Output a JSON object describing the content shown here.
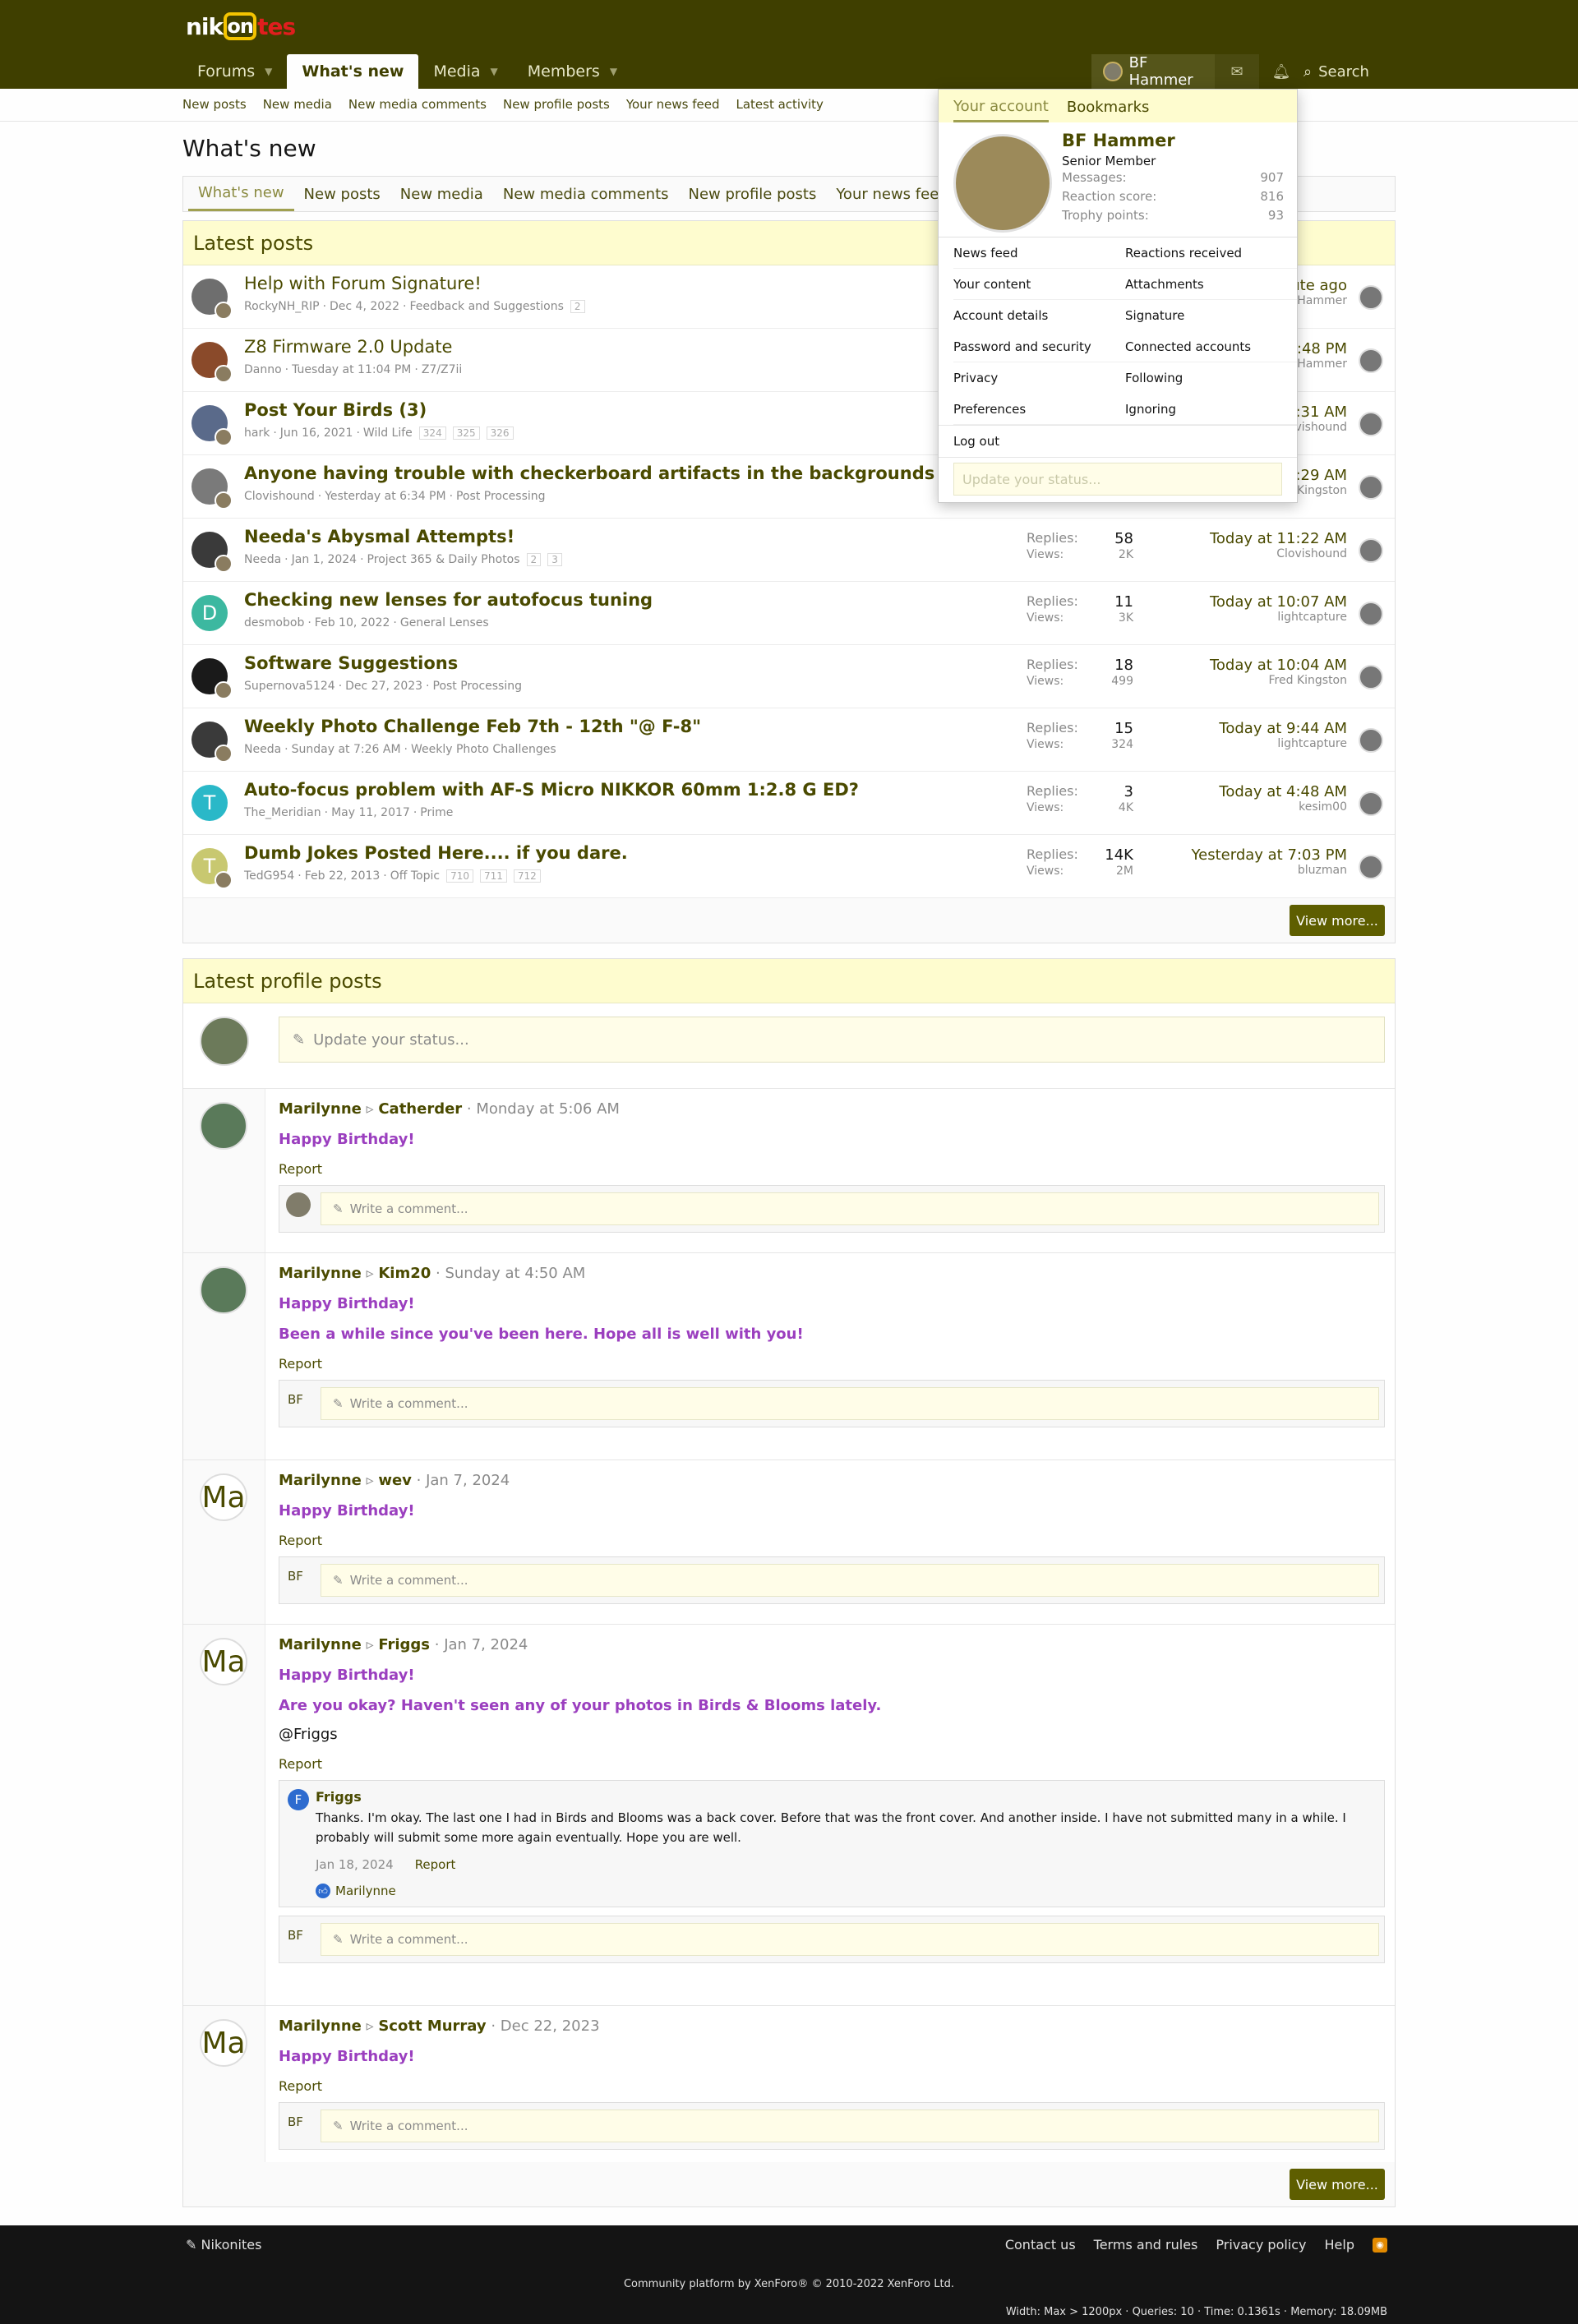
{
  "header": {
    "logo_a": "nik",
    "logo_b": "on",
    "logo_c": "tes",
    "nav": [
      {
        "label": "Forums",
        "dropdown": true
      },
      {
        "label": "What's new",
        "dropdown": false,
        "selected": true
      },
      {
        "label": "Media",
        "dropdown": true
      },
      {
        "label": "Members",
        "dropdown": true
      }
    ],
    "account_name": "BF Hammer",
    "search_label": "Search",
    "icons": [
      "envelope-icon",
      "bell-icon",
      "search-icon"
    ]
  },
  "subnav": [
    "New posts",
    "New media",
    "New media comments",
    "New profile posts",
    "Your news feed",
    "Latest activity"
  ],
  "page_title": "What's new",
  "tabs": [
    "What's new",
    "New posts",
    "New media",
    "New media comments",
    "New profile posts",
    "Your news feed",
    "Latest activity"
  ],
  "latest_posts": {
    "title": "Latest posts",
    "view_more": "View more...",
    "rows": [
      {
        "title": "Help with Forum Signature!",
        "bold": false,
        "author": "RockyNH_RIP",
        "date": "Dec 4, 2022",
        "forum": "Feedback and Suggestions",
        "pages": [
          "2"
        ],
        "replies": "",
        "views": "",
        "last_date": "A minute ago",
        "last_user": "BF Hammer",
        "avatar_color": "#6e6e6e",
        "avatar_text": ""
      },
      {
        "title": "Z8 Firmware 2.0 Update",
        "bold": false,
        "author": "Danno",
        "date": "Tuesday at 11:04 PM",
        "forum": "Z7/Z7ii",
        "pages": [],
        "replies": "",
        "views": "",
        "last_date": "Today at 12:48 PM",
        "last_user": "BF Hammer",
        "avatar_color": "#8a4a2a",
        "avatar_text": ""
      },
      {
        "title": "Post Your Birds (3)",
        "bold": true,
        "author": "hark",
        "date": "Jun 16, 2021",
        "forum": "Wild Life",
        "pages": [
          "324",
          "325",
          "326"
        ],
        "replies": "",
        "views": "",
        "last_date": "Today at 11:31 AM",
        "last_user": "Clovishound",
        "avatar_color": "#5a6a8a",
        "avatar_text": ""
      },
      {
        "title": "Anyone having trouble with checkerboard artifacts in the backgrounds with Topaz AI?",
        "bold": true,
        "author": "Clovishound",
        "date": "Yesterday at 6:34 PM",
        "forum": "Post Processing",
        "pages": [],
        "replies": "",
        "views": "",
        "last_date": "Today at 11:29 AM",
        "last_user": "Fred Kingston",
        "avatar_color": "#7a7a7a",
        "avatar_text": ""
      },
      {
        "title": "Needa's Abysmal Attempts!",
        "bold": true,
        "author": "Needa",
        "date": "Jan 1, 2024",
        "forum": "Project 365 & Daily Photos",
        "pages": [
          "2",
          "3"
        ],
        "replies": "58",
        "views": "2K",
        "last_date": "Today at 11:22 AM",
        "last_user": "Clovishound",
        "avatar_color": "#3a3a3a",
        "avatar_text": ""
      },
      {
        "title": "Checking new lenses for autofocus tuning",
        "bold": true,
        "author": "desmobob",
        "date": "Feb 10, 2022",
        "forum": "General Lenses",
        "pages": [],
        "replies": "11",
        "views": "3K",
        "last_date": "Today at 10:07 AM",
        "last_user": "lightcapture",
        "avatar_color": "#3cb8a0",
        "avatar_text": "D"
      },
      {
        "title": "Software Suggestions",
        "bold": true,
        "author": "Supernova5124",
        "date": "Dec 27, 2023",
        "forum": "Post Processing",
        "pages": [],
        "replies": "18",
        "views": "499",
        "last_date": "Today at 10:04 AM",
        "last_user": "Fred Kingston",
        "avatar_color": "#1a1a1a",
        "avatar_text": ""
      },
      {
        "title": "Weekly Photo Challenge Feb 7th - 12th \"@ F-8\"",
        "bold": true,
        "author": "Needa",
        "date": "Sunday at 7:26 AM",
        "forum": "Weekly Photo Challenges",
        "pages": [],
        "replies": "15",
        "views": "324",
        "last_date": "Today at 9:44 AM",
        "last_user": "lightcapture",
        "avatar_color": "#3a3a3a",
        "avatar_text": ""
      },
      {
        "title": "Auto-focus problem with AF-S Micro NIKKOR 60mm 1:2.8 G ED?",
        "bold": true,
        "author": "The_Meridian",
        "date": "May 11, 2017",
        "forum": "Prime",
        "pages": [],
        "replies": "3",
        "views": "4K",
        "last_date": "Today at 4:48 AM",
        "last_user": "kesim00",
        "avatar_color": "#2ab8c8",
        "avatar_text": "T"
      },
      {
        "title": "Dumb Jokes Posted Here.... if you dare.",
        "bold": true,
        "author": "TedG954",
        "date": "Feb 22, 2013",
        "forum": "Off Topic",
        "pages": [
          "710",
          "711",
          "712"
        ],
        "replies": "14K",
        "views": "2M",
        "last_date": "Yesterday at 7:03 PM",
        "last_user": "bluzman",
        "avatar_color": "#c8c870",
        "avatar_text": "T"
      }
    ],
    "labels": {
      "replies": "Replies:",
      "views": "Views:"
    }
  },
  "profile_posts": {
    "title": "Latest profile posts",
    "status_placeholder": "Update your status...",
    "comment_placeholder": "Write a comment...",
    "report": "Report",
    "view_more": "View more...",
    "bf": "BF",
    "posts": [
      {
        "author": "Marilynne",
        "target": "Catherder",
        "date": "Monday at 5:06 AM",
        "messages": [
          "Happy Birthday!"
        ],
        "plain": [],
        "photo": true,
        "reply": null
      },
      {
        "author": "Marilynne",
        "target": "Kim20",
        "date": "Sunday at 4:50 AM",
        "messages": [
          "Happy Birthday!",
          "Been a while since you've been here. Hope all is well with you!"
        ],
        "plain": [],
        "photo": true,
        "reply": null
      },
      {
        "author": "Marilynne",
        "target": "wev",
        "date": "Jan 7, 2024",
        "messages": [
          "Happy Birthday!"
        ],
        "plain": [],
        "photo": false,
        "reply": null
      },
      {
        "author": "Marilynne",
        "target": "Friggs",
        "date": "Jan 7, 2024",
        "messages": [
          "Happy Birthday!",
          "Are you okay? Haven't seen any of your photos in Birds & Blooms lately."
        ],
        "plain": [
          "@Friggs"
        ],
        "photo": false,
        "reply": {
          "initial": "F",
          "name": "Friggs",
          "text": "Thanks. I'm okay. The last one I had in Birds and Blooms was a back cover. Before that was the front cover. And another inside. I have not submitted many in a while. I probably will submit some more again eventually. Hope you are well.",
          "date": "Jan 18, 2024",
          "report": "Report",
          "liker": "Marilynne"
        }
      },
      {
        "author": "Marilynne",
        "target": "Scott Murray",
        "date": "Dec 22, 2023",
        "messages": [
          "Happy Birthday!"
        ],
        "plain": [],
        "photo": false,
        "reply": null
      }
    ],
    "ma": "Ma"
  },
  "account_menu": {
    "tab_account": "Your account",
    "tab_bookmarks": "Bookmarks",
    "name": "BF Hammer",
    "rank": "Senior Member",
    "stats": [
      {
        "label": "Messages:",
        "value": "907"
      },
      {
        "label": "Reaction score:",
        "value": "816"
      },
      {
        "label": "Trophy points:",
        "value": "93"
      }
    ],
    "links": [
      "News feed",
      "Reactions received",
      "Your content",
      "Attachments",
      "Account details",
      "Signature",
      "Password and security",
      "Connected accounts",
      "Privacy",
      "Following",
      "Preferences",
      "Ignoring"
    ],
    "logout": "Log out",
    "status_placeholder": "Update your status..."
  },
  "footer": {
    "brand": "Nikonites",
    "links": [
      "Contact us",
      "Terms and rules",
      "Privacy policy",
      "Help"
    ],
    "copyright": "Community platform by XenForo® © 2010-2022 XenForo Ltd.",
    "debug": "Width: Max > 1200px · Queries: 10 · Time: 0.1361s · Memory: 18.09MB"
  }
}
